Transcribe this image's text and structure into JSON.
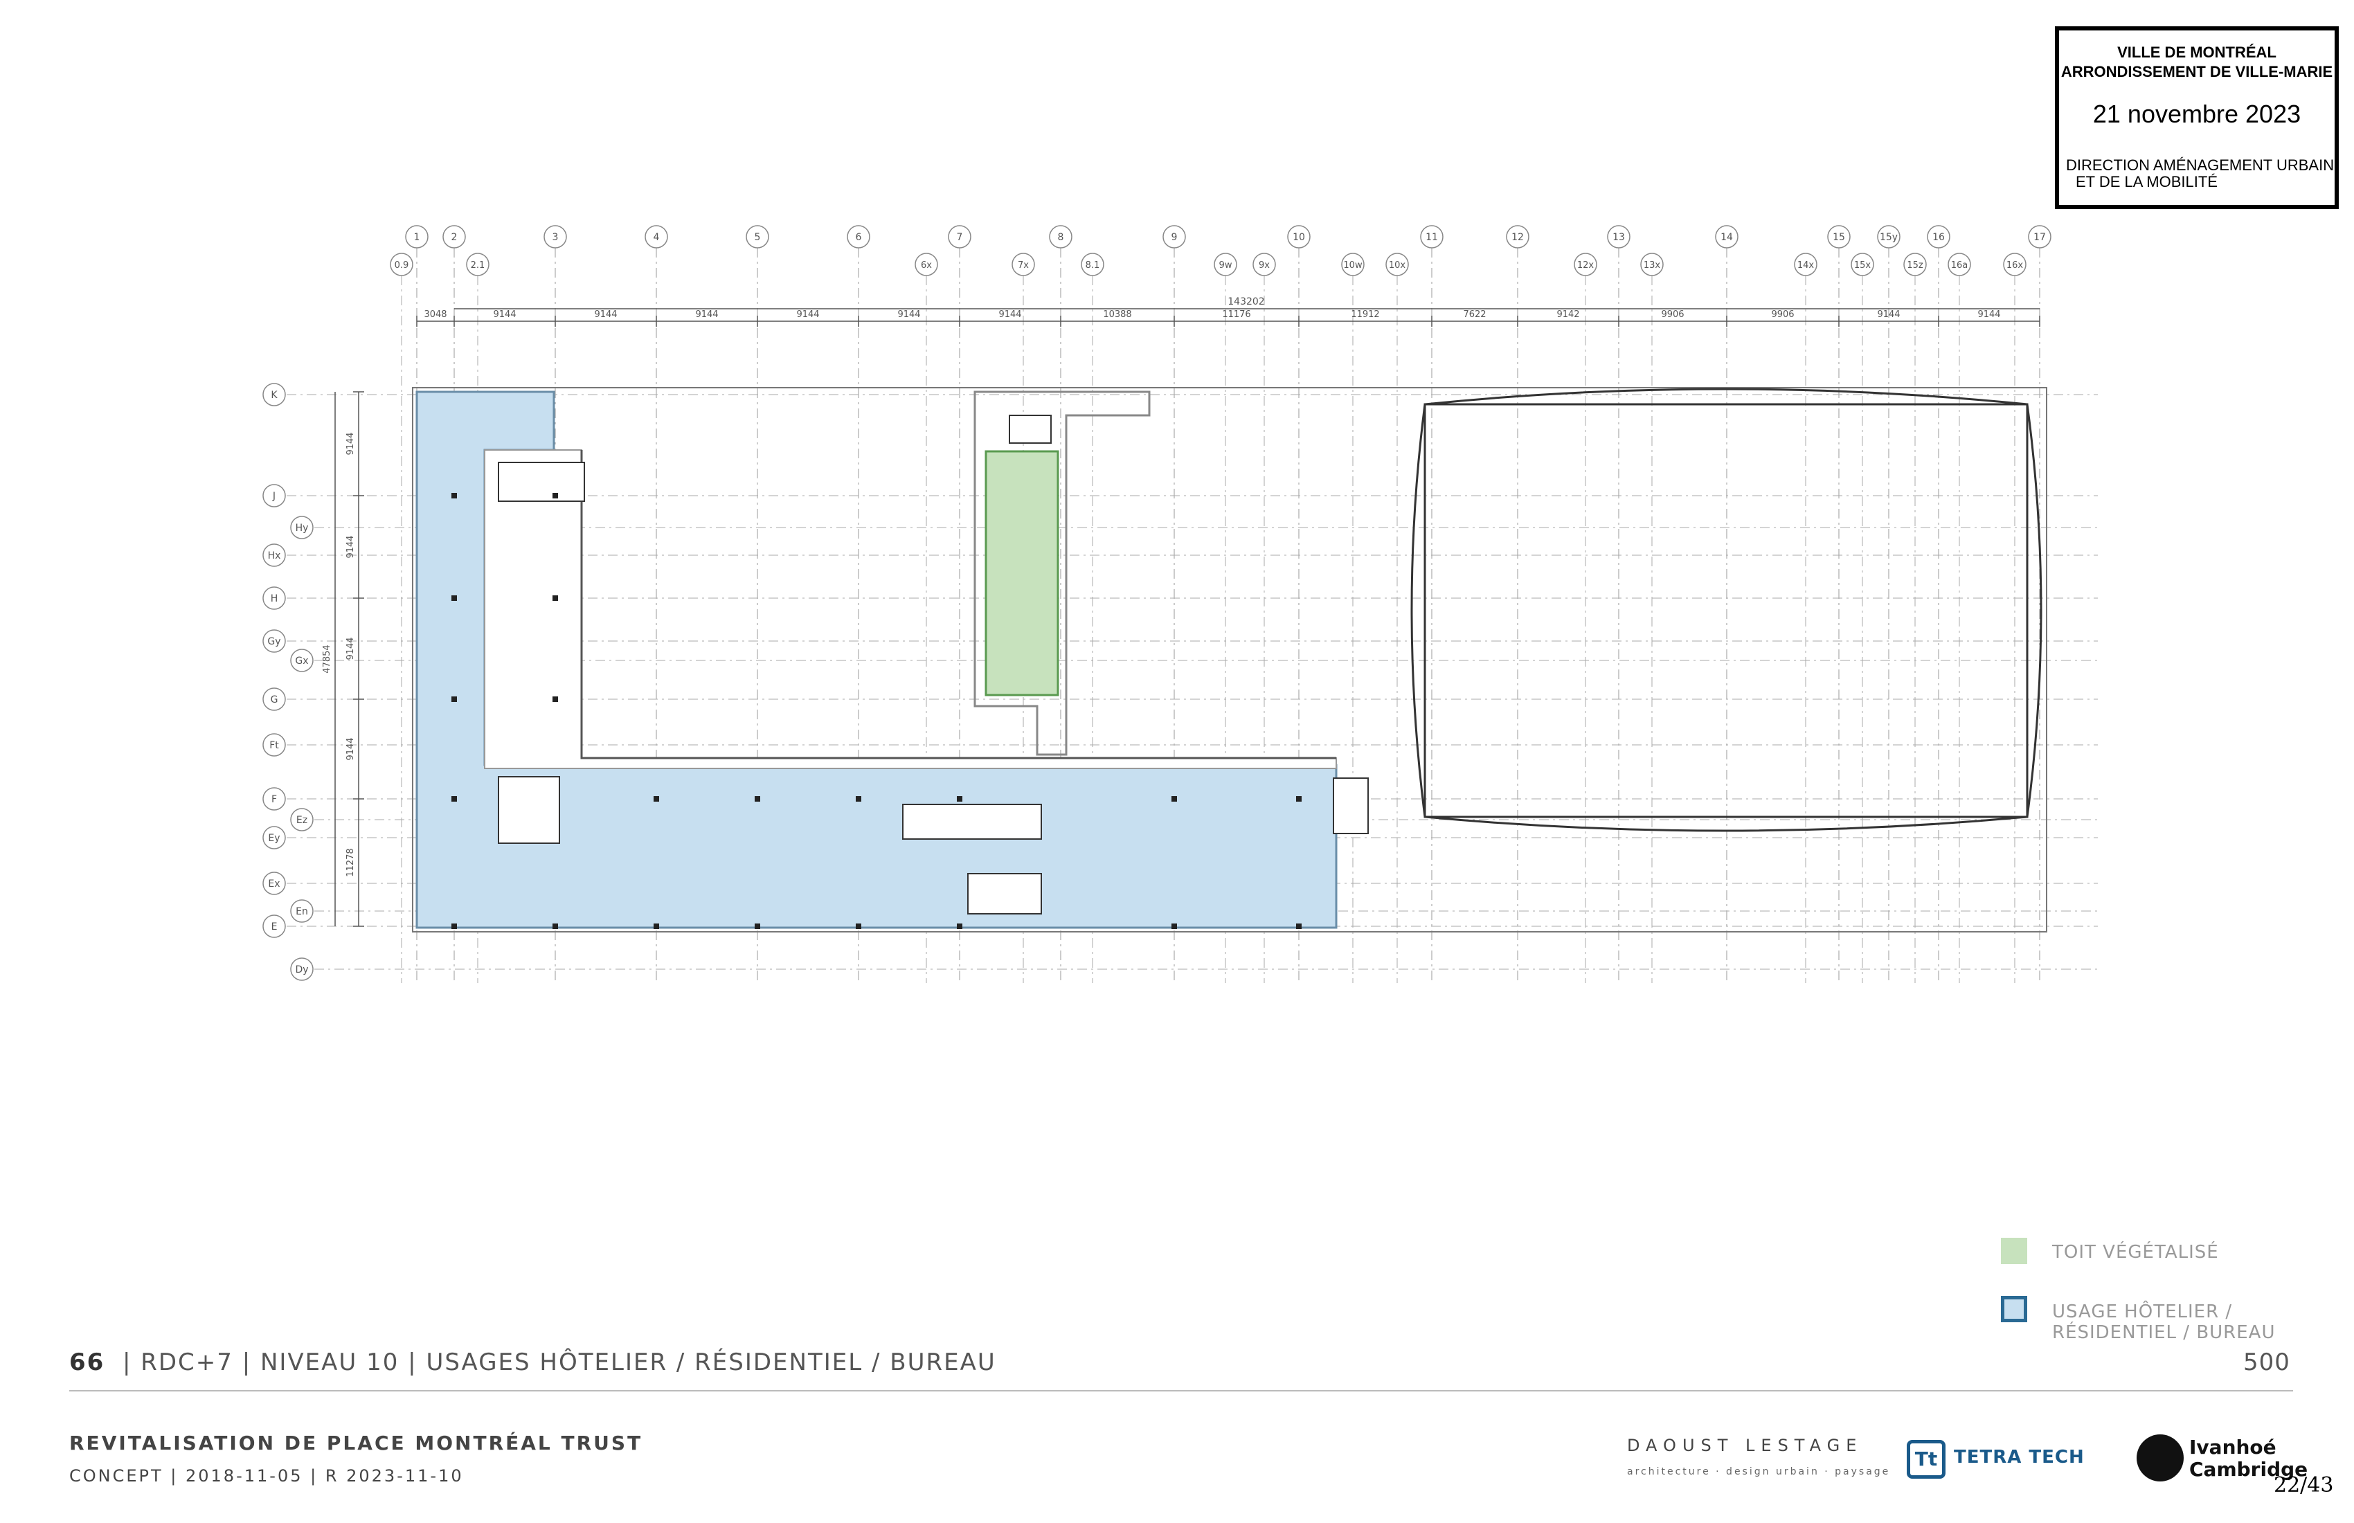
{
  "stamp": {
    "line1": "VILLE DE MONTRÉAL",
    "line2": "ARRONDISSEMENT DE VILLE-MARIE",
    "date": "21 novembre 2023",
    "dept1": "DIRECTION AMÉNAGEMENT URBAIN",
    "dept2": "ET DE LA MOBILITÉ"
  },
  "grid_top": [
    "1",
    "2",
    "3",
    "4",
    "5",
    "6",
    "7",
    "8",
    "9",
    "10",
    "11",
    "12",
    "13",
    "14",
    "15",
    "15y",
    "16",
    "17"
  ],
  "grid_top2": [
    "0.9",
    "2.1",
    "6x",
    "7x",
    "8.1",
    "9w",
    "9x",
    "10w",
    "10x",
    "12x",
    "13x",
    "14x",
    "15x",
    "15z",
    "16a",
    "16x"
  ],
  "grid_left": [
    "K",
    "J",
    "Hy",
    "Hx",
    "H",
    "Gy",
    "Gx",
    "G",
    "Ft",
    "F",
    "Ez",
    "Ey",
    "Ex",
    "En",
    "E",
    "Dy"
  ],
  "dims_top": [
    "3048",
    "9144",
    "9144",
    "9144",
    "9144",
    "9144",
    "9144",
    "10388",
    "11176",
    "11912",
    "7622",
    "9142",
    "9906",
    "9906",
    "9144",
    "9144"
  ],
  "dim_total": "143202",
  "dims_left": [
    "9144",
    "9144",
    "9144",
    "9144",
    "11278"
  ],
  "dim_left_total": "47854",
  "legend": {
    "green_label": "TOIT VÉGÉTALISÉ",
    "blue_label_1": "USAGE HÔTELIER /",
    "blue_label_2": "RÉSIDENTIEL / BUREAU",
    "green_color": "#c7e2bd",
    "blue_color": "#c7dff0"
  },
  "footer": {
    "page_no": "66",
    "title": "|  RDC+7 | NIVEAU 10 | USAGES HÔTELIER / RÉSIDENTIEL / BUREAU",
    "scale": "500",
    "project": "REVITALISATION DE PLACE MONTRÉAL TRUST",
    "concept": "CONCEPT | 2018-11-05 | R 2023-11-10",
    "daoust": "DAOUST LESTAGE",
    "daoust_sub": "architecture · design urbain · paysage",
    "tetra": "TETRA TECH",
    "ivanhoe1": "Ivanhoé",
    "ivanhoe2": "Cambridge",
    "page_count": "22/43"
  }
}
